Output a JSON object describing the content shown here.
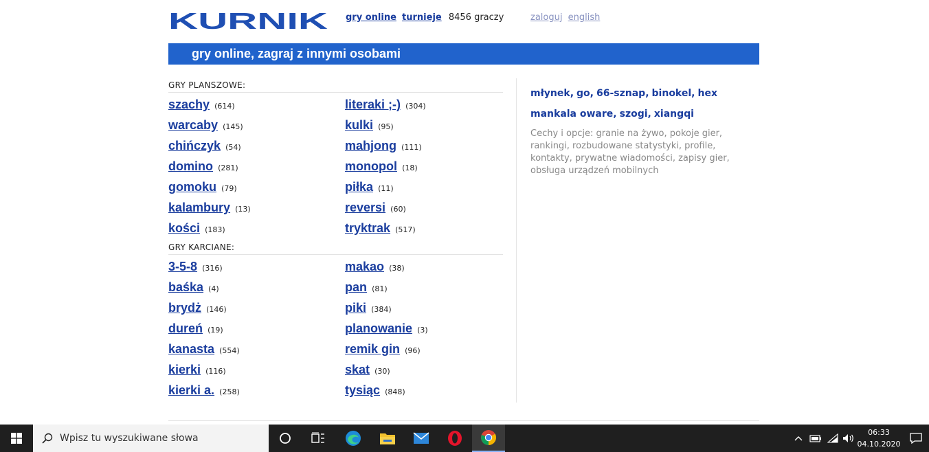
{
  "header": {
    "logo_text": "KURNIK",
    "nav": [
      {
        "label": "gry online"
      },
      {
        "label": "turnieje"
      }
    ],
    "player_count": "8456 graczy",
    "user_links": [
      {
        "label": "zaloguj"
      },
      {
        "label": "english"
      }
    ]
  },
  "banner": {
    "title": "gry online, zagraj z innymi osobami"
  },
  "board_games": {
    "title": "GRY PLANSZOWE:",
    "items": [
      {
        "name": "szachy",
        "count": "(614)"
      },
      {
        "name": "literaki ;-)",
        "count": "(304)"
      },
      {
        "name": "warcaby",
        "count": "(145)"
      },
      {
        "name": "kulki",
        "count": "(95)"
      },
      {
        "name": "chińczyk",
        "count": "(54)"
      },
      {
        "name": "mahjong",
        "count": "(111)"
      },
      {
        "name": "domino",
        "count": "(281)"
      },
      {
        "name": "monopol",
        "count": "(18)"
      },
      {
        "name": "gomoku",
        "count": "(79)"
      },
      {
        "name": "piłka",
        "count": "(11)"
      },
      {
        "name": "kalambury",
        "count": "(13)"
      },
      {
        "name": "reversi",
        "count": "(60)"
      },
      {
        "name": "kości",
        "count": "(183)"
      },
      {
        "name": "tryktrak",
        "count": "(517)"
      }
    ]
  },
  "card_games": {
    "title": "GRY KARCIANE:",
    "items": [
      {
        "name": "3-5-8",
        "count": "(316)"
      },
      {
        "name": "makao",
        "count": "(38)"
      },
      {
        "name": "baśka",
        "count": "(4)"
      },
      {
        "name": "pan",
        "count": "(81)"
      },
      {
        "name": "brydż",
        "count": "(146)"
      },
      {
        "name": "piki",
        "count": "(384)"
      },
      {
        "name": "dureń",
        "count": "(19)"
      },
      {
        "name": "planowanie",
        "count": "(3)"
      },
      {
        "name": "kanasta",
        "count": "(554)"
      },
      {
        "name": "remik gin",
        "count": "(96)"
      },
      {
        "name": "kierki",
        "count": "(116)"
      },
      {
        "name": "skat",
        "count": "(30)"
      },
      {
        "name": "kierki a.",
        "count": "(258)"
      },
      {
        "name": "tysiąc",
        "count": "(848)"
      }
    ]
  },
  "other_games": {
    "line1": [
      "młynek",
      "go",
      "66-sznap",
      "binokel",
      "hex"
    ],
    "line2": [
      "mankala oware",
      "szogi",
      "xiangqi"
    ],
    "separator": ",",
    "description": "Cechy i opcje: granie na żywo, pokoje gier, rankingi, rozbudowane statystyki, profile, kontakty, prywatne wiadomości, zapisy gier, obsługa urządzeń mobilnych"
  },
  "taskbar": {
    "search_placeholder": "Wpisz tu wyszukiwane słowa",
    "time": "06:33",
    "date": "04.10.2020"
  },
  "colors": {
    "brand_blue": "#2163cc",
    "link_blue": "#1a3d9e",
    "taskbar_bg": "#1f1f1f"
  },
  "icons": [
    "windows-start-icon",
    "search-icon",
    "cortana-icon",
    "task-view-icon",
    "edge-icon",
    "file-explorer-icon",
    "mail-icon",
    "opera-icon",
    "chrome-icon",
    "chevron-up-icon",
    "battery-icon",
    "wifi-icon",
    "volume-icon",
    "notification-icon"
  ]
}
